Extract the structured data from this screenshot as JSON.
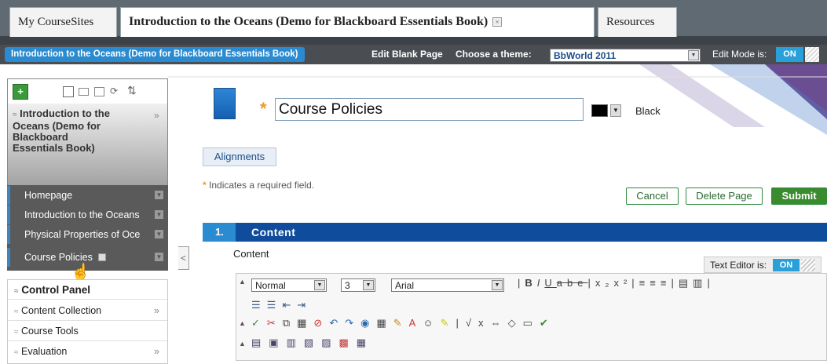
{
  "tabs": [
    {
      "label": "My CourseSites"
    },
    {
      "label": "Introduction to the Oceans (Demo for Blackboard Essentials Book)",
      "close": "×"
    },
    {
      "label": "Resources"
    }
  ],
  "navbar": {
    "breadcrumb": "Introduction to the Oceans (Demo for Blackboard Essentials Book)",
    "edit_page": "Edit Blank Page",
    "theme_label": "Choose a theme:",
    "theme_value": "BbWorld 2011",
    "edit_mode_label": "Edit Mode is:",
    "edit_mode_value": "ON"
  },
  "left": {
    "add": "+",
    "course_title": "Introduction to the Oceans (Demo for Blackboard Essentials Book)",
    "items": [
      {
        "label": "Homepage"
      },
      {
        "label": "Introduction to the Oceans"
      },
      {
        "label": "Physical Properties of Oce"
      },
      {
        "label": "Course Policies"
      }
    ],
    "collapse": "<"
  },
  "control_panel": {
    "title": "Control Panel",
    "items": [
      {
        "label": "Content Collection",
        "arrow": "»"
      },
      {
        "label": "Course Tools",
        "arrow": ""
      },
      {
        "label": "Evaluation",
        "arrow": "»"
      }
    ]
  },
  "content": {
    "title_value": "Course Policies",
    "color_name": "Black",
    "alignments": "Alignments",
    "required_note": "Indicates a required field.",
    "cancel": "Cancel",
    "delete": "Delete Page",
    "submit": "Submit",
    "section_num": "1.",
    "section_title": "Content",
    "content_label": "Content",
    "text_editor_label": "Text Editor is:",
    "text_editor_value": "ON",
    "format_value": "Normal",
    "size_value": "3",
    "font_value": "Arial"
  },
  "colors": {
    "accent_blue": "#2a8bd0",
    "section_bar": "#0f4c9c",
    "submit_green": "#3a8a2e"
  }
}
